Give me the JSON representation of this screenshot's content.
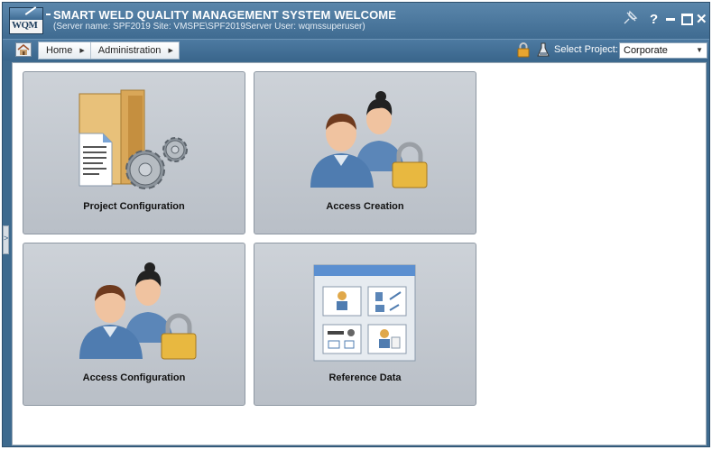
{
  "window": {
    "logo_text": "WQM",
    "title": "SMART WELD QUALITY MANAGEMENT SYSTEM",
    "welcome": "WELCOME",
    "server_info": "(Server name: SPF2019 Site: VMSPE\\SPF2019Server User: wqmssuperuser)",
    "help_label": "?",
    "close_label": "✕"
  },
  "navbar": {
    "breadcrumb": [
      {
        "label": "Home"
      },
      {
        "label": "Administration"
      }
    ],
    "select_project_label": "Select Project:",
    "project_value": "Corporate"
  },
  "tiles": [
    {
      "label": "Project Configuration",
      "icon": "folder-gears-icon"
    },
    {
      "label": "Access Creation",
      "icon": "users-lock-icon"
    },
    {
      "label": "Access Configuration",
      "icon": "users-lock-icon"
    },
    {
      "label": "Reference Data",
      "icon": "reference-panel-icon"
    }
  ],
  "colors": {
    "titlebar": "#4a769c",
    "accent_blue": "#5b86b8",
    "tile_bg": "#c6cbd1"
  }
}
